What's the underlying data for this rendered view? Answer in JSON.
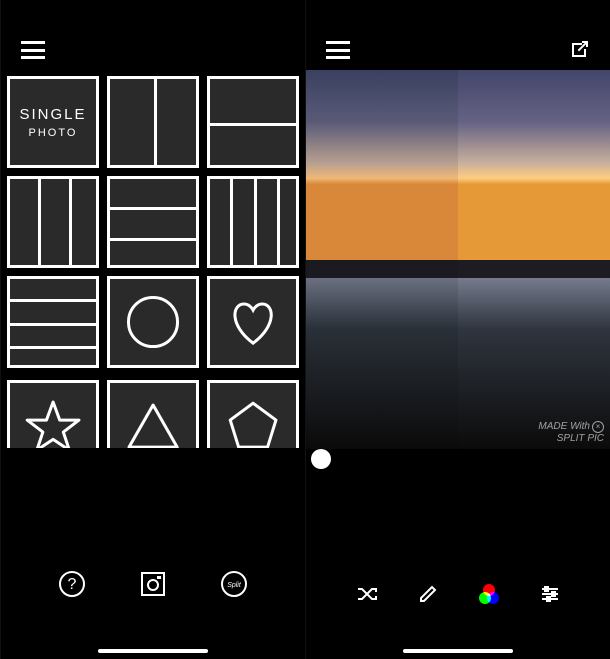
{
  "left": {
    "layouts": {
      "single_label": "SINGLE",
      "single_sub": "PHOTO"
    },
    "toolbar": {
      "help": "help",
      "camera": "camera",
      "logo": "logo"
    }
  },
  "right": {
    "watermark_line1": "MADE With",
    "watermark_line2": "SPLIT PIC",
    "toolbar": {
      "shuffle": "shuffle",
      "edit": "edit",
      "color": "color",
      "adjust": "adjust"
    }
  },
  "icons": {
    "menu": "menu-icon",
    "share": "share-icon"
  }
}
